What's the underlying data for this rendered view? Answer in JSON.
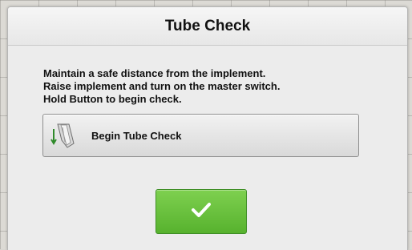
{
  "dialog": {
    "title": "Tube Check",
    "instructions": [
      "Maintain a safe distance from the implement.",
      "Raise implement and turn on the master switch.",
      "Hold Button to begin check."
    ],
    "begin_button": {
      "label": "Begin Tube Check",
      "icon": "seed-tube-icon"
    },
    "confirm_button": {
      "icon": "checkmark-icon",
      "color": "#62bd37"
    }
  }
}
